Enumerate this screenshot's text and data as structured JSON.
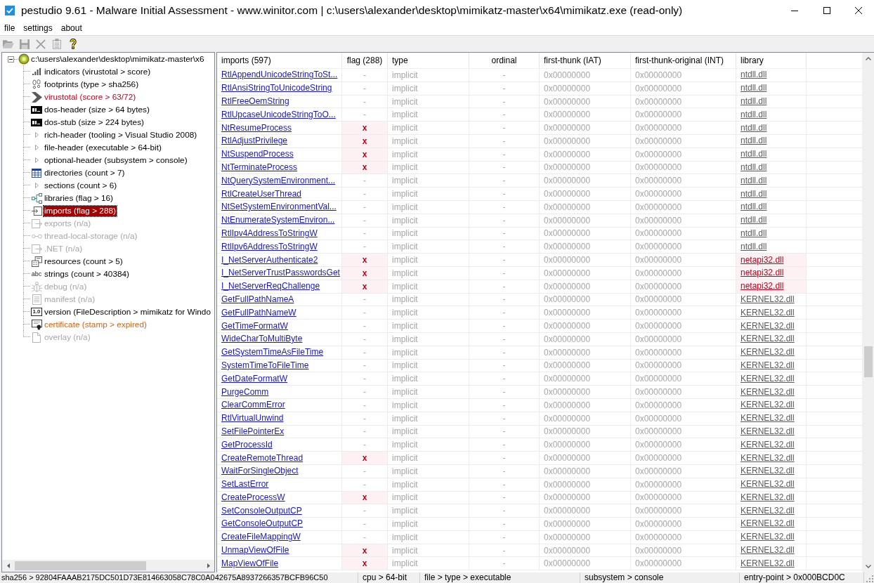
{
  "window": {
    "title": "pestudio 9.61 - Malware Initial Assessment - www.winitor.com | c:\\users\\alexander\\desktop\\mimikatz-master\\x64\\mimikatz.exe (read-only)"
  },
  "menu": [
    {
      "label": "file"
    },
    {
      "label": "settings"
    },
    {
      "label": "about"
    }
  ],
  "toolbar": [
    {
      "kind": "open",
      "disabled": true
    },
    {
      "kind": "save",
      "disabled": true
    },
    {
      "kind": "cut",
      "disabled": true
    },
    {
      "kind": "clipboard",
      "disabled": true
    },
    {
      "kind": "help",
      "disabled": false
    }
  ],
  "tree": {
    "label": "c:\\users\\alexander\\desktop\\mimikatz-master\\x6",
    "expanded": true,
    "selected": false,
    "children": [
      {
        "label": "indicators (virustotal > score)",
        "kind": "bars",
        "selected": false,
        "flagged": false,
        "warning": false,
        "disabled": false
      },
      {
        "label": "footprints (type > sha256)",
        "kind": "prints",
        "selected": false,
        "flagged": false,
        "warning": false,
        "disabled": false
      },
      {
        "label": "virustotal (score > 63/72)",
        "kind": "chevron",
        "selected": false,
        "flagged": true,
        "warning": false,
        "disabled": false
      },
      {
        "label": "dos-header (size > 64 bytes)",
        "kind": "console",
        "selected": false,
        "flagged": false,
        "warning": false,
        "disabled": false
      },
      {
        "label": "dos-stub (size > 224 bytes)",
        "kind": "console",
        "selected": false,
        "flagged": false,
        "warning": false,
        "disabled": false
      },
      {
        "label": "rich-header (tooling > Visual Studio 2008)",
        "kind": "triangle",
        "selected": false,
        "flagged": false,
        "warning": false,
        "disabled": false
      },
      {
        "label": "file-header (executable > 64-bit)",
        "kind": "triangle",
        "selected": false,
        "flagged": false,
        "warning": false,
        "disabled": false
      },
      {
        "label": "optional-header (subsystem > console)",
        "kind": "triangle",
        "selected": false,
        "flagged": false,
        "warning": false,
        "disabled": false
      },
      {
        "label": "directories (count > 7)",
        "kind": "grid",
        "selected": false,
        "flagged": false,
        "warning": false,
        "disabled": false
      },
      {
        "label": "sections (count > 6)",
        "kind": "triangle",
        "selected": false,
        "flagged": false,
        "warning": false,
        "disabled": false
      },
      {
        "label": "libraries (flag > 16)",
        "kind": "nodes",
        "selected": false,
        "flagged": false,
        "warning": false,
        "disabled": false
      },
      {
        "label": "imports (flag > 288)",
        "kind": "import",
        "selected": true,
        "flagged": false,
        "warning": false,
        "disabled": false
      },
      {
        "label": "exports (n/a)",
        "kind": "export",
        "selected": false,
        "flagged": false,
        "warning": false,
        "disabled": true
      },
      {
        "label": "thread-local-storage (n/a)",
        "kind": "chain",
        "selected": false,
        "flagged": false,
        "warning": false,
        "disabled": true
      },
      {
        "label": ".NET (n/a)",
        "kind": "export",
        "selected": false,
        "flagged": false,
        "warning": false,
        "disabled": true
      },
      {
        "label": "resources (count > 5)",
        "kind": "windows",
        "selected": false,
        "flagged": false,
        "warning": false,
        "disabled": false
      },
      {
        "label": "strings (count > 40384)",
        "kind": "glyph",
        "glyph": "abc",
        "selected": false,
        "flagged": false,
        "warning": false,
        "disabled": false
      },
      {
        "label": "debug (n/a)",
        "kind": "bug",
        "selected": false,
        "flagged": false,
        "warning": false,
        "disabled": true
      },
      {
        "label": "manifest (n/a)",
        "kind": "document",
        "selected": false,
        "flagged": false,
        "warning": false,
        "disabled": true
      },
      {
        "label": "version (FileDescription > mimikatz for Windo",
        "kind": "badge",
        "glyph": "1.0",
        "selected": false,
        "flagged": false,
        "warning": false,
        "disabled": false
      },
      {
        "label": "certificate (stamp > expired)",
        "kind": "certificate",
        "selected": false,
        "flagged": false,
        "warning": true,
        "disabled": false
      },
      {
        "label": "overlay (n/a)",
        "kind": "page",
        "selected": false,
        "flagged": false,
        "warning": false,
        "disabled": true
      }
    ]
  },
  "table": {
    "columns": [
      {
        "label": "imports (597)"
      },
      {
        "label": "flag (288)"
      },
      {
        "label": "type"
      },
      {
        "label": "ordinal"
      },
      {
        "label": "first-thunk (IAT)"
      },
      {
        "label": "first-thunk-original (INT)"
      },
      {
        "label": "library"
      }
    ],
    "rows": [
      {
        "name": "RtlAppendUnicodeStringToSt...",
        "flag": "-",
        "flagged": false,
        "type": "implicit",
        "ordinal": "-",
        "first_thunk_iat": "0x00000000",
        "first_thunk_int": "0x00000000",
        "library": "ntdll.dll",
        "library_flagged": false
      },
      {
        "name": "RtlAnsiStringToUnicodeString",
        "flag": "-",
        "flagged": false,
        "type": "implicit",
        "ordinal": "-",
        "first_thunk_iat": "0x00000000",
        "first_thunk_int": "0x00000000",
        "library": "ntdll.dll",
        "library_flagged": false
      },
      {
        "name": "RtlFreeOemString",
        "flag": "-",
        "flagged": false,
        "type": "implicit",
        "ordinal": "-",
        "first_thunk_iat": "0x00000000",
        "first_thunk_int": "0x00000000",
        "library": "ntdll.dll",
        "library_flagged": false
      },
      {
        "name": "RtlUpcaseUnicodeStringToO...",
        "flag": "-",
        "flagged": false,
        "type": "implicit",
        "ordinal": "-",
        "first_thunk_iat": "0x00000000",
        "first_thunk_int": "0x00000000",
        "library": "ntdll.dll",
        "library_flagged": false
      },
      {
        "name": "NtResumeProcess",
        "flag": "x",
        "flagged": true,
        "type": "implicit",
        "ordinal": "-",
        "first_thunk_iat": "0x00000000",
        "first_thunk_int": "0x00000000",
        "library": "ntdll.dll",
        "library_flagged": false
      },
      {
        "name": "RtlAdjustPrivilege",
        "flag": "x",
        "flagged": true,
        "type": "implicit",
        "ordinal": "-",
        "first_thunk_iat": "0x00000000",
        "first_thunk_int": "0x00000000",
        "library": "ntdll.dll",
        "library_flagged": false
      },
      {
        "name": "NtSuspendProcess",
        "flag": "x",
        "flagged": true,
        "type": "implicit",
        "ordinal": "-",
        "first_thunk_iat": "0x00000000",
        "first_thunk_int": "0x00000000",
        "library": "ntdll.dll",
        "library_flagged": false
      },
      {
        "name": "NtTerminateProcess",
        "flag": "x",
        "flagged": true,
        "type": "implicit",
        "ordinal": "-",
        "first_thunk_iat": "0x00000000",
        "first_thunk_int": "0x00000000",
        "library": "ntdll.dll",
        "library_flagged": false
      },
      {
        "name": "NtQuerySystemEnvironment...",
        "flag": "-",
        "flagged": false,
        "type": "implicit",
        "ordinal": "-",
        "first_thunk_iat": "0x00000000",
        "first_thunk_int": "0x00000000",
        "library": "ntdll.dll",
        "library_flagged": false
      },
      {
        "name": "RtlCreateUserThread",
        "flag": "-",
        "flagged": false,
        "type": "implicit",
        "ordinal": "-",
        "first_thunk_iat": "0x00000000",
        "first_thunk_int": "0x00000000",
        "library": "ntdll.dll",
        "library_flagged": false
      },
      {
        "name": "NtSetSystemEnvironmentVal...",
        "flag": "-",
        "flagged": false,
        "type": "implicit",
        "ordinal": "-",
        "first_thunk_iat": "0x00000000",
        "first_thunk_int": "0x00000000",
        "library": "ntdll.dll",
        "library_flagged": false
      },
      {
        "name": "NtEnumerateSystemEnviron...",
        "flag": "-",
        "flagged": false,
        "type": "implicit",
        "ordinal": "-",
        "first_thunk_iat": "0x00000000",
        "first_thunk_int": "0x00000000",
        "library": "ntdll.dll",
        "library_flagged": false
      },
      {
        "name": "RtlIpv4AddressToStringW",
        "flag": "-",
        "flagged": false,
        "type": "implicit",
        "ordinal": "-",
        "first_thunk_iat": "0x00000000",
        "first_thunk_int": "0x00000000",
        "library": "ntdll.dll",
        "library_flagged": false
      },
      {
        "name": "RtlIpv6AddressToStringW",
        "flag": "-",
        "flagged": false,
        "type": "implicit",
        "ordinal": "-",
        "first_thunk_iat": "0x00000000",
        "first_thunk_int": "0x00000000",
        "library": "ntdll.dll",
        "library_flagged": false
      },
      {
        "name": "I_NetServerAuthenticate2",
        "flag": "x",
        "flagged": true,
        "type": "implicit",
        "ordinal": "-",
        "first_thunk_iat": "0x00000000",
        "first_thunk_int": "0x00000000",
        "library": "netapi32.dll",
        "library_flagged": true
      },
      {
        "name": "I_NetServerTrustPasswordsGet",
        "flag": "x",
        "flagged": true,
        "type": "implicit",
        "ordinal": "-",
        "first_thunk_iat": "0x00000000",
        "first_thunk_int": "0x00000000",
        "library": "netapi32.dll",
        "library_flagged": true
      },
      {
        "name": "I_NetServerReqChallenge",
        "flag": "x",
        "flagged": true,
        "type": "implicit",
        "ordinal": "-",
        "first_thunk_iat": "0x00000000",
        "first_thunk_int": "0x00000000",
        "library": "netapi32.dll",
        "library_flagged": true
      },
      {
        "name": "GetFullPathNameA",
        "flag": "-",
        "flagged": false,
        "type": "implicit",
        "ordinal": "-",
        "first_thunk_iat": "0x00000000",
        "first_thunk_int": "0x00000000",
        "library": "KERNEL32.dll",
        "library_flagged": false
      },
      {
        "name": "GetFullPathNameW",
        "flag": "-",
        "flagged": false,
        "type": "implicit",
        "ordinal": "-",
        "first_thunk_iat": "0x00000000",
        "first_thunk_int": "0x00000000",
        "library": "KERNEL32.dll",
        "library_flagged": false
      },
      {
        "name": "GetTimeFormatW",
        "flag": "-",
        "flagged": false,
        "type": "implicit",
        "ordinal": "-",
        "first_thunk_iat": "0x00000000",
        "first_thunk_int": "0x00000000",
        "library": "KERNEL32.dll",
        "library_flagged": false
      },
      {
        "name": "WideCharToMultiByte",
        "flag": "-",
        "flagged": false,
        "type": "implicit",
        "ordinal": "-",
        "first_thunk_iat": "0x00000000",
        "first_thunk_int": "0x00000000",
        "library": "KERNEL32.dll",
        "library_flagged": false
      },
      {
        "name": "GetSystemTimeAsFileTime",
        "flag": "-",
        "flagged": false,
        "type": "implicit",
        "ordinal": "-",
        "first_thunk_iat": "0x00000000",
        "first_thunk_int": "0x00000000",
        "library": "KERNEL32.dll",
        "library_flagged": false
      },
      {
        "name": "SystemTimeToFileTime",
        "flag": "-",
        "flagged": false,
        "type": "implicit",
        "ordinal": "-",
        "first_thunk_iat": "0x00000000",
        "first_thunk_int": "0x00000000",
        "library": "KERNEL32.dll",
        "library_flagged": false
      },
      {
        "name": "GetDateFormatW",
        "flag": "-",
        "flagged": false,
        "type": "implicit",
        "ordinal": "-",
        "first_thunk_iat": "0x00000000",
        "first_thunk_int": "0x00000000",
        "library": "KERNEL32.dll",
        "library_flagged": false
      },
      {
        "name": "PurgeComm",
        "flag": "-",
        "flagged": false,
        "type": "implicit",
        "ordinal": "-",
        "first_thunk_iat": "0x00000000",
        "first_thunk_int": "0x00000000",
        "library": "KERNEL32.dll",
        "library_flagged": false
      },
      {
        "name": "ClearCommError",
        "flag": "-",
        "flagged": false,
        "type": "implicit",
        "ordinal": "-",
        "first_thunk_iat": "0x00000000",
        "first_thunk_int": "0x00000000",
        "library": "KERNEL32.dll",
        "library_flagged": false
      },
      {
        "name": "RtlVirtualUnwind",
        "flag": "-",
        "flagged": false,
        "type": "implicit",
        "ordinal": "-",
        "first_thunk_iat": "0x00000000",
        "first_thunk_int": "0x00000000",
        "library": "KERNEL32.dll",
        "library_flagged": false
      },
      {
        "name": "SetFilePointerEx",
        "flag": "-",
        "flagged": false,
        "type": "implicit",
        "ordinal": "-",
        "first_thunk_iat": "0x00000000",
        "first_thunk_int": "0x00000000",
        "library": "KERNEL32.dll",
        "library_flagged": false
      },
      {
        "name": "GetProcessId",
        "flag": "-",
        "flagged": false,
        "type": "implicit",
        "ordinal": "-",
        "first_thunk_iat": "0x00000000",
        "first_thunk_int": "0x00000000",
        "library": "KERNEL32.dll",
        "library_flagged": false
      },
      {
        "name": "CreateRemoteThread",
        "flag": "x",
        "flagged": true,
        "type": "implicit",
        "ordinal": "-",
        "first_thunk_iat": "0x00000000",
        "first_thunk_int": "0x00000000",
        "library": "KERNEL32.dll",
        "library_flagged": false
      },
      {
        "name": "WaitForSingleObject",
        "flag": "-",
        "flagged": false,
        "type": "implicit",
        "ordinal": "-",
        "first_thunk_iat": "0x00000000",
        "first_thunk_int": "0x00000000",
        "library": "KERNEL32.dll",
        "library_flagged": false
      },
      {
        "name": "SetLastError",
        "flag": "-",
        "flagged": false,
        "type": "implicit",
        "ordinal": "-",
        "first_thunk_iat": "0x00000000",
        "first_thunk_int": "0x00000000",
        "library": "KERNEL32.dll",
        "library_flagged": false
      },
      {
        "name": "CreateProcessW",
        "flag": "x",
        "flagged": true,
        "type": "implicit",
        "ordinal": "-",
        "first_thunk_iat": "0x00000000",
        "first_thunk_int": "0x00000000",
        "library": "KERNEL32.dll",
        "library_flagged": false
      },
      {
        "name": "SetConsoleOutputCP",
        "flag": "-",
        "flagged": false,
        "type": "implicit",
        "ordinal": "-",
        "first_thunk_iat": "0x00000000",
        "first_thunk_int": "0x00000000",
        "library": "KERNEL32.dll",
        "library_flagged": false
      },
      {
        "name": "GetConsoleOutputCP",
        "flag": "-",
        "flagged": false,
        "type": "implicit",
        "ordinal": "-",
        "first_thunk_iat": "0x00000000",
        "first_thunk_int": "0x00000000",
        "library": "KERNEL32.dll",
        "library_flagged": false
      },
      {
        "name": "CreateFileMappingW",
        "flag": "-",
        "flagged": false,
        "type": "implicit",
        "ordinal": "-",
        "first_thunk_iat": "0x00000000",
        "first_thunk_int": "0x00000000",
        "library": "KERNEL32.dll",
        "library_flagged": false
      },
      {
        "name": "UnmapViewOfFile",
        "flag": "x",
        "flagged": true,
        "type": "implicit",
        "ordinal": "-",
        "first_thunk_iat": "0x00000000",
        "first_thunk_int": "0x00000000",
        "library": "KERNEL32.dll",
        "library_flagged": false
      },
      {
        "name": "MapViewOfFile",
        "flag": "x",
        "flagged": true,
        "type": "implicit",
        "ordinal": "-",
        "first_thunk_iat": "0x00000000",
        "first_thunk_int": "0x00000000",
        "library": "KERNEL32.dll",
        "library_flagged": false
      }
    ]
  },
  "status_bar": [
    "sha256 > 92804FAAAB2175DC501D73E814663058C78C0A042675A8937266357BCFB96C50",
    "cpu > 64-bit",
    "file > type > executable",
    "subsystem > console",
    "entry-point > 0x000BCD0C"
  ]
}
